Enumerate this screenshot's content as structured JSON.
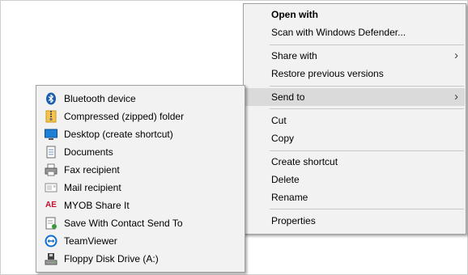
{
  "main_menu": {
    "items": [
      {
        "label": "Open with",
        "bold": true
      },
      {
        "label": "Scan with Windows Defender..."
      },
      {
        "label": "Share with",
        "has_submenu": true
      },
      {
        "label": "Restore previous versions"
      },
      {
        "label": "Send to",
        "has_submenu": true,
        "highlighted": true
      },
      {
        "label": "Cut"
      },
      {
        "label": "Copy"
      },
      {
        "label": "Create shortcut"
      },
      {
        "label": "Delete"
      },
      {
        "label": "Rename"
      },
      {
        "label": "Properties"
      }
    ],
    "chevron": "›"
  },
  "send_to_menu": {
    "items": [
      {
        "label": "Bluetooth device",
        "icon": "bluetooth-icon"
      },
      {
        "label": "Compressed (zipped) folder",
        "icon": "zip-folder-icon"
      },
      {
        "label": "Desktop (create shortcut)",
        "icon": "desktop-icon"
      },
      {
        "label": "Documents",
        "icon": "documents-icon"
      },
      {
        "label": "Fax recipient",
        "icon": "fax-icon"
      },
      {
        "label": "Mail recipient",
        "icon": "mail-icon"
      },
      {
        "label": "MYOB Share It",
        "icon": "myob-icon",
        "icon_text": "AE"
      },
      {
        "label": "Save With Contact Send To",
        "icon": "contact-send-icon"
      },
      {
        "label": "TeamViewer",
        "icon": "teamviewer-icon"
      },
      {
        "label": "Floppy Disk Drive (A:)",
        "icon": "floppy-drive-icon"
      }
    ]
  },
  "colors": {
    "menu_bg": "#f2f2f2",
    "highlight": "#dadada",
    "bluetooth": "#1c5fb0",
    "teamviewer": "#0e6fd1",
    "myob": "#c8102e"
  }
}
